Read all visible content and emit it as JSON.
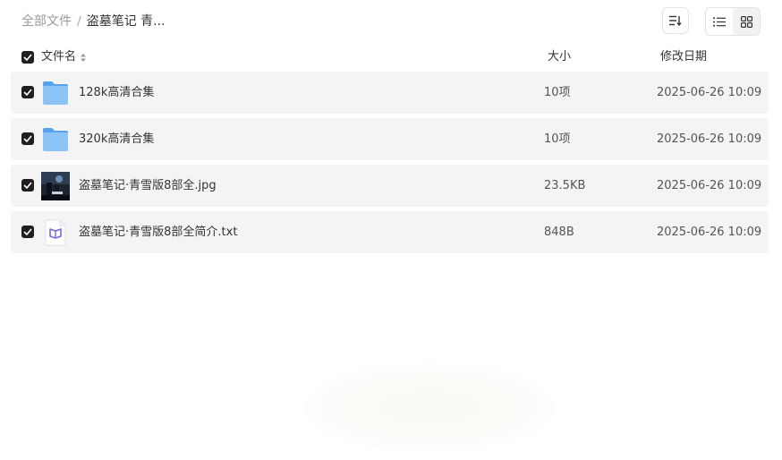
{
  "breadcrumb": {
    "root": "全部文件",
    "separator": "/",
    "current": "盗墓笔记 青..."
  },
  "toolbar": {
    "sort_icon": "sort-icon",
    "list_view_icon": "list-view-icon",
    "grid_view_icon": "grid-view-icon"
  },
  "table": {
    "headers": {
      "name": "文件名",
      "size": "大小",
      "date": "修改日期"
    },
    "rows": [
      {
        "icon": "folder-icon",
        "name": "128k高清合集",
        "size": "10项",
        "date": "2025-06-26 10:09",
        "checked": true
      },
      {
        "icon": "folder-icon",
        "name": "320k高清合集",
        "size": "10项",
        "date": "2025-06-26 10:09",
        "checked": true
      },
      {
        "icon": "image-thumbnail",
        "name": "盗墓笔记·青雪版8部全.jpg",
        "size": "23.5KB",
        "date": "2025-06-26 10:09",
        "checked": true
      },
      {
        "icon": "text-file-icon",
        "name": "盗墓笔记·青雪版8部全简介.txt",
        "size": "848B",
        "date": "2025-06-26 10:09",
        "checked": true
      }
    ]
  },
  "colors": {
    "folder": "#7db8f2",
    "row_bg": "#f4f4f4",
    "checkbox": "#1f1f1f",
    "txt_icon_accent": "#7b6ad8"
  }
}
